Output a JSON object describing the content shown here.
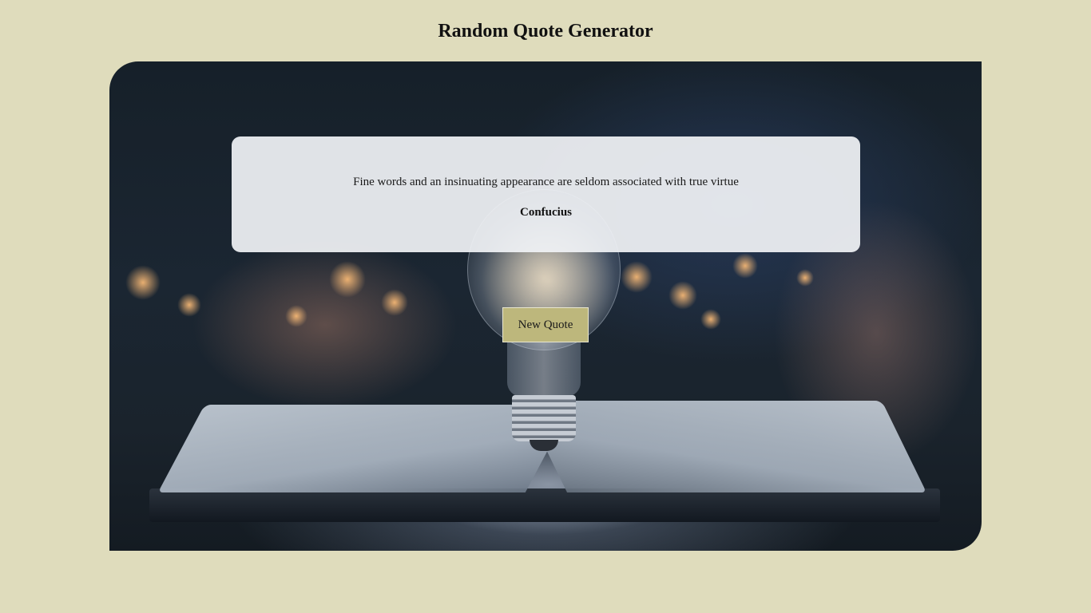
{
  "page": {
    "title": "Random Quote Generator"
  },
  "quote": {
    "text": "Fine words and an insinuating appearance are seldom associated with true virtue",
    "author": "Confucius"
  },
  "actions": {
    "new_quote_label": "New Quote"
  },
  "colors": {
    "page_background": "#dfdcbc",
    "button_background": "#bdb77c",
    "card_background": "#f0f2f5"
  }
}
